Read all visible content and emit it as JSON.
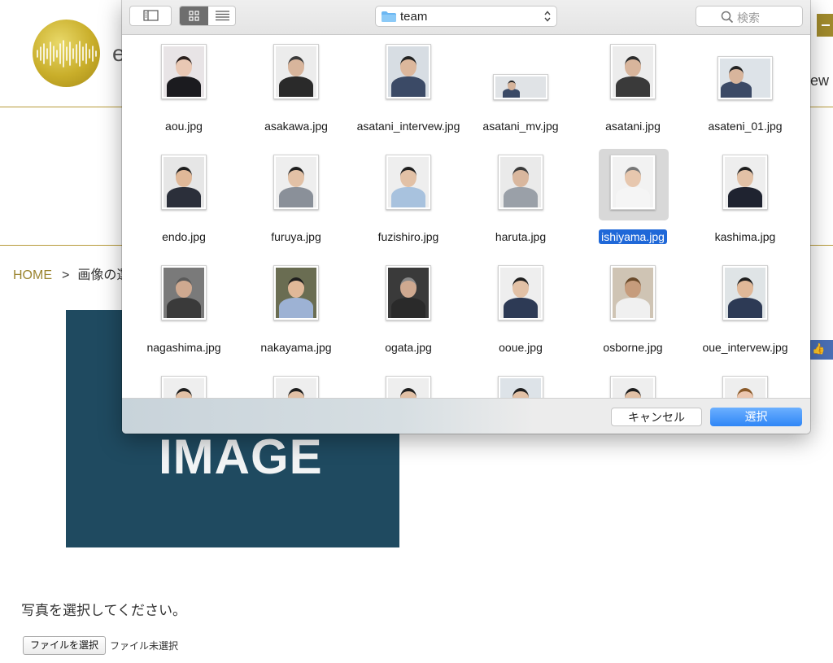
{
  "page": {
    "logo_letter": "e",
    "header_right_text": "ew",
    "breadcrumb": {
      "home": "HOME",
      "separator": ">",
      "current": "画像の選"
    },
    "image_placeholder_text": "IMAGE",
    "prompt": "写真を選択してください。",
    "file_button": "ファイルを選択",
    "file_status": "ファイル未選択",
    "fb_like": "L"
  },
  "dialog": {
    "current_folder": "team",
    "search_placeholder": "検索",
    "view_mode": "icon",
    "cancel_label": "キャンセル",
    "select_label": "選択",
    "selected_file": "ishiyama.jpg",
    "files": [
      {
        "name": "aou.jpg"
      },
      {
        "name": "asakawa.jpg"
      },
      {
        "name": "asatani_intervew.jpg"
      },
      {
        "name": "asatani_mv.jpg"
      },
      {
        "name": "asatani.jpg"
      },
      {
        "name": "asateni_01.jpg"
      },
      {
        "name": "endo.jpg"
      },
      {
        "name": "furuya.jpg"
      },
      {
        "name": "fuzishiro.jpg"
      },
      {
        "name": "haruta.jpg"
      },
      {
        "name": "ishiyama.jpg"
      },
      {
        "name": "kashima.jpg"
      },
      {
        "name": "nagashima.jpg"
      },
      {
        "name": "nakayama.jpg"
      },
      {
        "name": "ogata.jpg"
      },
      {
        "name": "ooue.jpg"
      },
      {
        "name": "osborne.jpg"
      },
      {
        "name": "oue_intervew.jpg"
      },
      {
        "name": ""
      },
      {
        "name": ""
      },
      {
        "name": ""
      },
      {
        "name": ""
      },
      {
        "name": ""
      },
      {
        "name": ""
      }
    ]
  },
  "colors": {
    "accent_gold": "#a08a2c",
    "selection_blue": "#1f68d8",
    "image_block": "#1f4a60"
  }
}
